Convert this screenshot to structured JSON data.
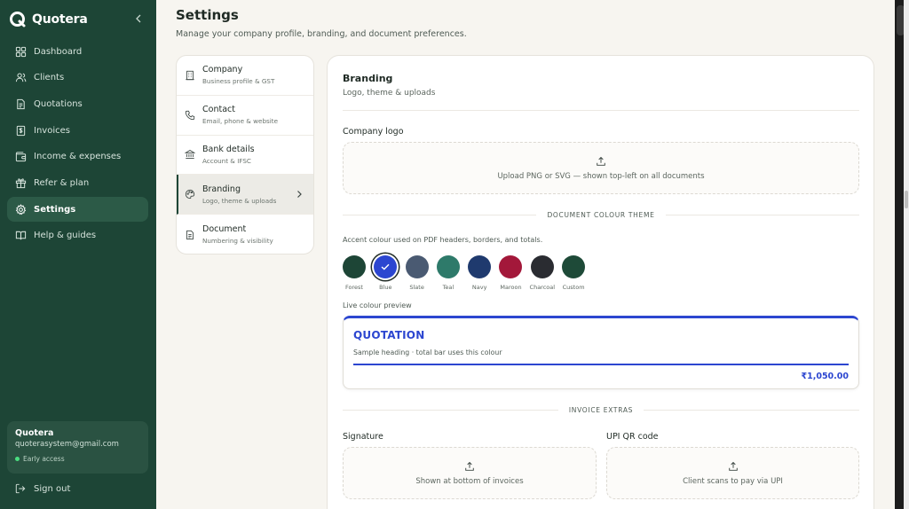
{
  "brand": {
    "name": "Quotera"
  },
  "sidebar": {
    "items": [
      {
        "label": "Dashboard",
        "icon": "grid-icon"
      },
      {
        "label": "Clients",
        "icon": "users-icon"
      },
      {
        "label": "Quotations",
        "icon": "document-icon"
      },
      {
        "label": "Invoices",
        "icon": "receipt-icon"
      },
      {
        "label": "Income & expenses",
        "icon": "wallet-icon"
      },
      {
        "label": "Refer & plan",
        "icon": "gift-icon"
      },
      {
        "label": "Settings",
        "icon": "gear-icon",
        "active": true
      },
      {
        "label": "Help & guides",
        "icon": "book-icon"
      }
    ],
    "account": {
      "name": "Quotera",
      "email": "quoterasystem@gmail.com",
      "badge": "Early access"
    },
    "signout": "Sign out"
  },
  "header": {
    "title": "Settings",
    "subtitle": "Manage your company profile, branding, and document preferences."
  },
  "subnav": [
    {
      "title": "Company",
      "sub": "Business profile & GST",
      "icon": "building-icon"
    },
    {
      "title": "Contact",
      "sub": "Email, phone & website",
      "icon": "phone-icon"
    },
    {
      "title": "Bank details",
      "sub": "Account & IFSC",
      "icon": "bank-icon"
    },
    {
      "title": "Branding",
      "sub": "Logo, theme & uploads",
      "icon": "palette-icon",
      "active": true
    },
    {
      "title": "Document",
      "sub": "Numbering & visibility",
      "icon": "file-icon"
    }
  ],
  "branding": {
    "title": "Branding",
    "subtitle": "Logo, theme & uploads",
    "logo_label": "Company logo",
    "logo_hint": "Upload PNG or SVG — shown top-left on all documents",
    "theme_section": "DOCUMENT COLOUR THEME",
    "accent_hint": "Accent colour used on PDF headers, borders, and totals.",
    "swatches": [
      {
        "name": "Forest",
        "color": "#1d4536"
      },
      {
        "name": "Blue",
        "color": "#2c46d0",
        "selected": true
      },
      {
        "name": "Slate",
        "color": "#4a5a72"
      },
      {
        "name": "Teal",
        "color": "#2e7a6a"
      },
      {
        "name": "Navy",
        "color": "#1f3a6e"
      },
      {
        "name": "Maroon",
        "color": "#a3183a"
      },
      {
        "name": "Charcoal",
        "color": "#2a2c31"
      },
      {
        "name": "Custom",
        "color": "#1e4a38"
      }
    ],
    "preview_label": "Live colour preview",
    "preview": {
      "heading": "QUOTATION",
      "sub": "Sample heading · total bar uses this colour",
      "amount": "₹1,050.00"
    },
    "extras_section": "INVOICE EXTRAS",
    "signature_label": "Signature",
    "signature_hint": "Shown at bottom of invoices",
    "upi_label": "UPI QR code",
    "upi_hint": "Client scans to pay via UPI"
  }
}
